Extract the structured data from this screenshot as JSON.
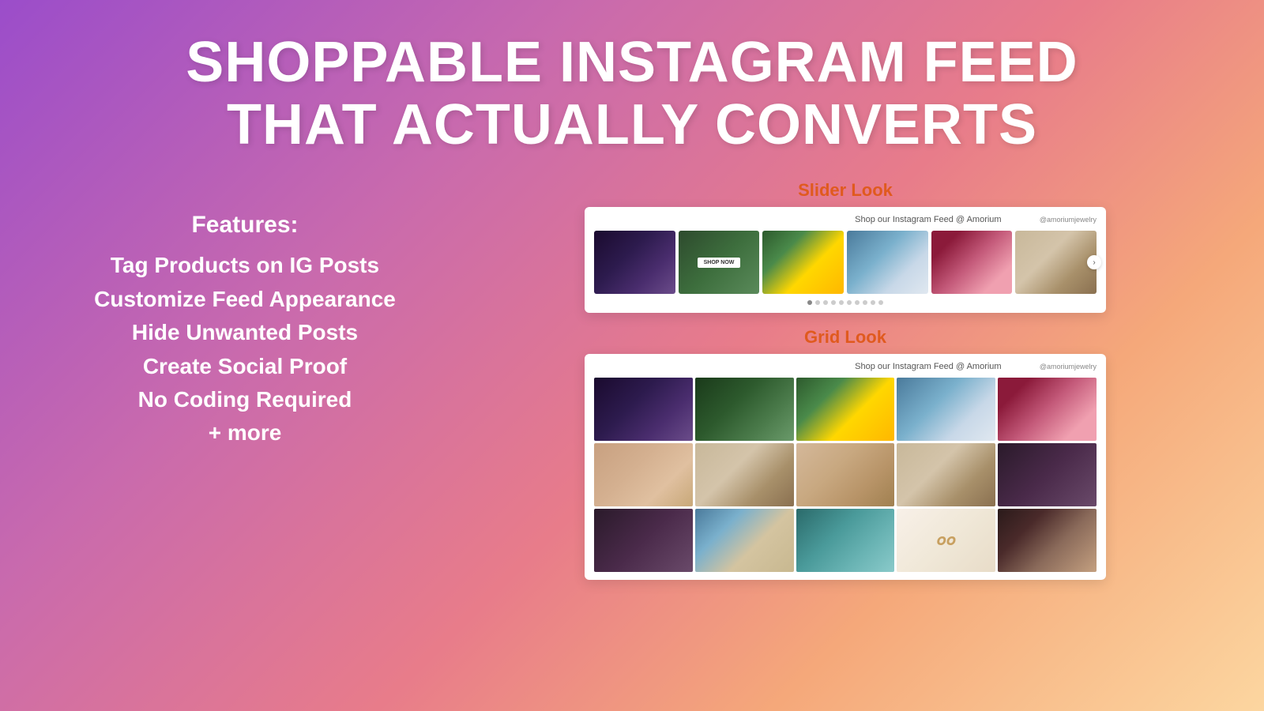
{
  "headline": {
    "line1": "SHOPPABLE INSTAGRAM FEED",
    "line2": "THAT ACTUALLY CONVERTS"
  },
  "features": {
    "title": "Features:",
    "items": [
      "Tag Products on IG Posts",
      "Customize Feed Appearance",
      "Hide Unwanted Posts",
      "Create Social Proof",
      "No Coding Required",
      "+ more"
    ]
  },
  "slider": {
    "label": "Slider Look",
    "header_text": "Shop our Instagram Feed @ Amorium",
    "username": "@amoriumjewelry",
    "dots_count": 10
  },
  "grid": {
    "label": "Grid Look",
    "header_text": "Shop our Instagram Feed @ Amorium",
    "username": "@amoriumjewelry"
  }
}
